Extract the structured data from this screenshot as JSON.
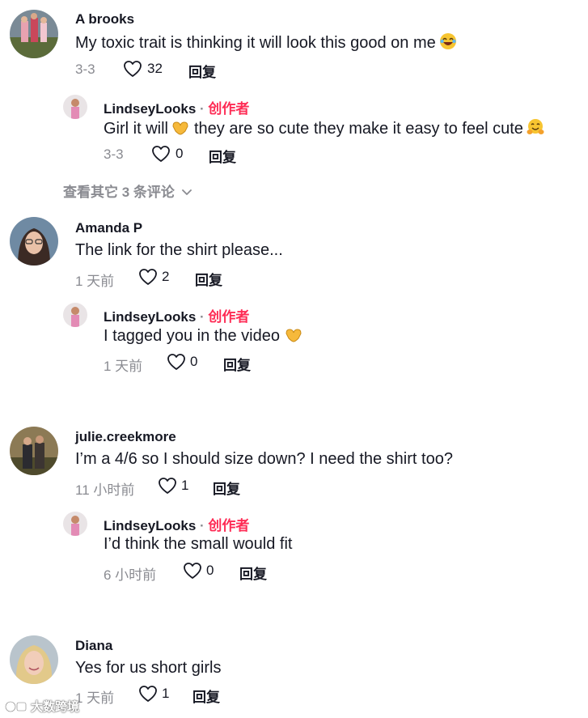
{
  "reply_label": "回复",
  "author_badge": "创作者",
  "threads": [
    {
      "user": "A brooks",
      "text": "My toxic trait is thinking it will look this good on me",
      "time": "3-3",
      "likes": "32",
      "reply": {
        "user": "LindseyLooks",
        "text_a": "Girl it will",
        "text_b": "they are so cute they make it easy to feel cute",
        "time": "3-3",
        "likes": "0"
      },
      "more_replies": "查看其它 3 条评论"
    },
    {
      "user": "Amanda P",
      "text": "The link for the shirt please...",
      "time": "1 天前",
      "likes": "2",
      "reply": {
        "user": "LindseyLooks",
        "text": "I tagged you in the video",
        "time": "1 天前",
        "likes": "0"
      }
    },
    {
      "user": "julie.creekmore",
      "text": "I’m a 4/6 so I should size down? I need the shirt too?",
      "time": "11 小时前",
      "likes": "1",
      "reply": {
        "user": "LindseyLooks",
        "text": "I’d think the small would fit",
        "time": "6 小时前",
        "likes": "0"
      }
    },
    {
      "user": "Diana",
      "text": "Yes for us short girls",
      "time": "1 天前",
      "likes": "1"
    }
  ],
  "watermark": "大数跨境",
  "icons": [
    "heart-outline-icon",
    "chevron-down-icon",
    "laughing-emoji",
    "heart-hands-emoji",
    "hugging-face-emoji"
  ],
  "colors": {
    "author": "#fe2c55",
    "meta": "#8a8b91",
    "text": "#161823"
  }
}
